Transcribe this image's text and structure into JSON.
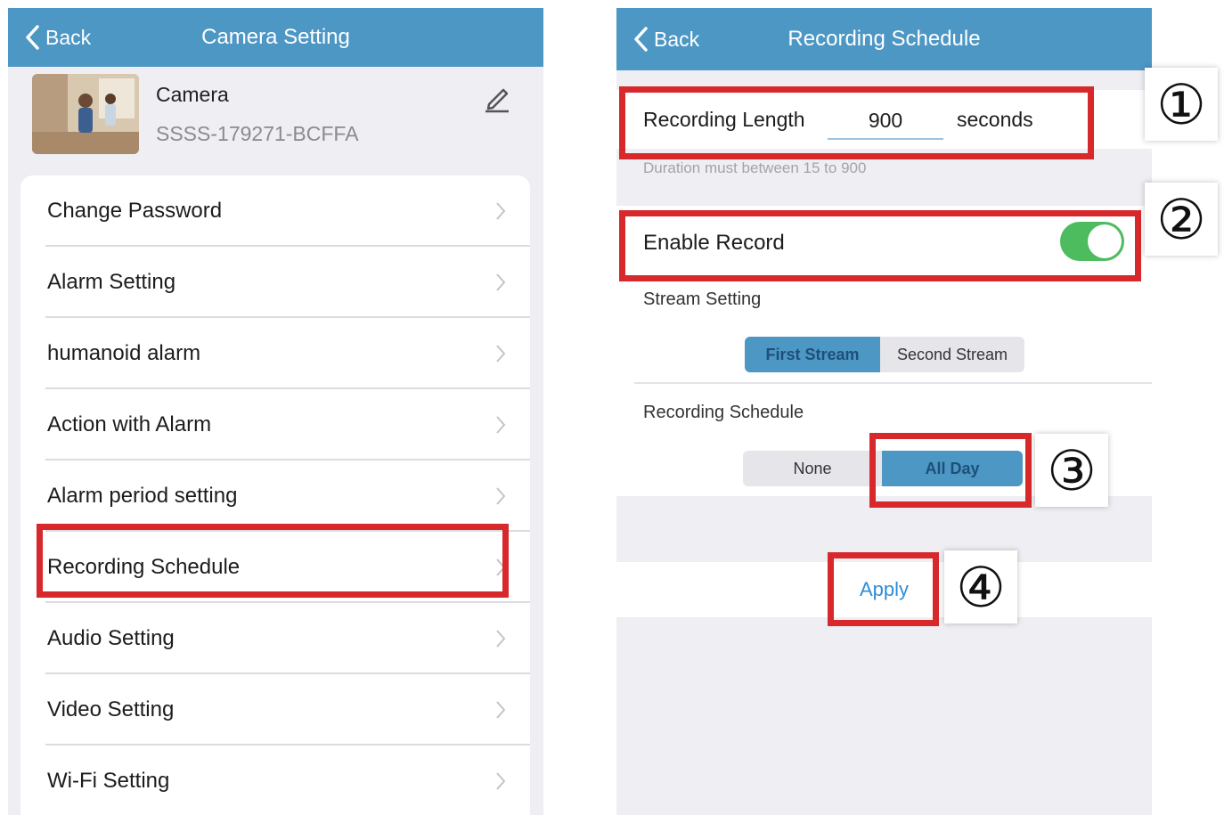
{
  "left_screen": {
    "back_label": "Back",
    "title": "Camera Setting",
    "camera": {
      "name": "Camera",
      "id": "SSSS-179271-BCFFA"
    },
    "menu": [
      {
        "label": "Change Password"
      },
      {
        "label": "Alarm Setting"
      },
      {
        "label": "humanoid alarm"
      },
      {
        "label": "Action with Alarm"
      },
      {
        "label": "Alarm period setting"
      },
      {
        "label": "Recording Schedule"
      },
      {
        "label": "Audio Setting"
      },
      {
        "label": "Video Setting"
      },
      {
        "label": "Wi-Fi Setting"
      }
    ]
  },
  "right_screen": {
    "back_label": "Back",
    "title": "Recording Schedule",
    "recording_length": {
      "label": "Recording Length",
      "value": "900",
      "unit": "seconds",
      "hint": "Duration must between 15 to 900"
    },
    "enable_record": {
      "label": "Enable Record",
      "on": true
    },
    "stream_setting": {
      "label": "Stream Setting",
      "options": [
        "First Stream",
        "Second Stream"
      ],
      "selected": "First Stream"
    },
    "recording_schedule": {
      "label": "Recording Schedule",
      "options": [
        "None",
        "All Day"
      ],
      "selected": "All Day"
    },
    "apply_label": "Apply"
  },
  "annotations": {
    "step1": "①",
    "step2": "②",
    "step3": "③",
    "step4": "④"
  },
  "colors": {
    "navbar": "#4d97c5",
    "highlight": "#d7282b",
    "toggle_on": "#4cbc5f",
    "link": "#2e8dd6"
  }
}
